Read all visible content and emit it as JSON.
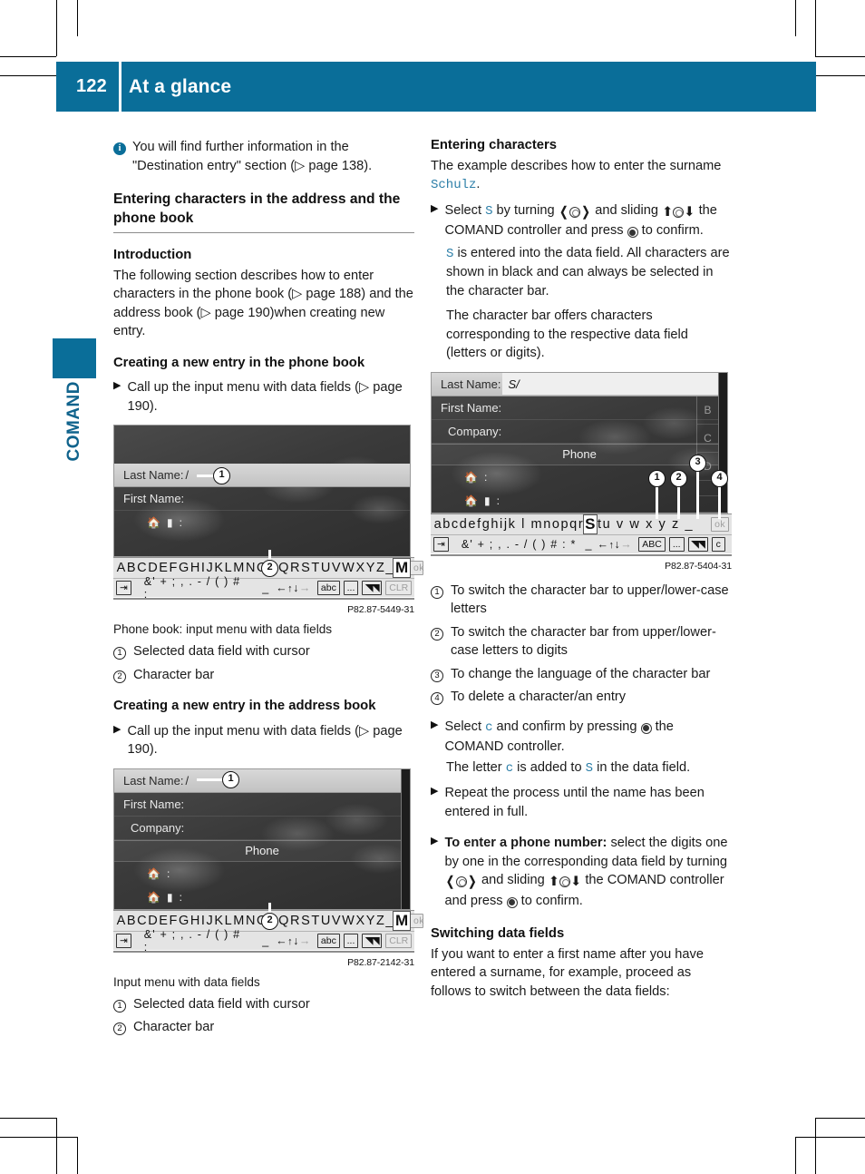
{
  "theme": {
    "brand": "#0a6e99",
    "link_blue": "#2d7fa8"
  },
  "header": {
    "page_number": "122",
    "chapter_title": "At a glance",
    "side_tab_label": "COMAND"
  },
  "left_column": {
    "note": {
      "icon": "info-icon",
      "text": "You will find further information in the \"Destination entry\" section (▷ page 138)."
    },
    "section_heading": "Entering characters in the address and the phone book",
    "intro_heading": "Introduction",
    "intro_text": "The following section describes how to enter characters in the phone book (▷ page 188) and the address book (▷ page 190)when creating new entry.",
    "phonebook_heading": "Creating a new entry in the phone book",
    "phonebook_step": "Call up the input menu with data fields (▷ page 190).",
    "figure1": {
      "fields": [
        {
          "label": "Last Name:",
          "value": "/",
          "selected": true
        },
        {
          "label": "First Name:",
          "value": "",
          "selected": false
        }
      ],
      "icon_rows": [
        {
          "icons": "house-icon mobile-icon",
          "label": ":"
        }
      ],
      "charbar_upper": "ABCDEFGHIJKLMNOPQRSTUVWXYZ_",
      "charbar_highlight": "M",
      "charbar_ok": "ok",
      "charbar_symbols": "&' + ; , . - / ( ) # :",
      "charbar_underscore": "_",
      "charbar_keys": [
        "abc",
        "...",
        "flag-icon",
        "CLR"
      ],
      "back_key": "back-icon",
      "ref": "P82.87-5449-31",
      "caption": "Phone book: input menu with data fields",
      "legend": [
        {
          "num": "1",
          "text": "Selected data field with cursor"
        },
        {
          "num": "2",
          "text": "Character bar"
        }
      ],
      "callouts": [
        "1",
        "2"
      ]
    },
    "addressbook_heading": "Creating a new entry in the address book",
    "addressbook_step": "Call up the input menu with data fields (▷ page 190).",
    "figure2": {
      "fields": [
        {
          "label": "Last Name:",
          "value": "/",
          "selected": true
        },
        {
          "label": "First Name:",
          "value": "",
          "selected": false
        },
        {
          "label": "Company:",
          "value": "",
          "selected": false
        }
      ],
      "section_header": "Phone",
      "icon_rows": [
        {
          "icons": "house-icon",
          "label": ":"
        },
        {
          "icons": "house-icon mobile-icon",
          "label": ":"
        }
      ],
      "charbar_upper": "ABCDEFGHIJKLMNOPQRSTUVWXYZ_",
      "charbar_highlight": "M",
      "charbar_ok": "ok",
      "charbar_symbols": "&' + ; , . - / ( ) # :",
      "charbar_keys": [
        "abc",
        "...",
        "flag-icon",
        "CLR"
      ],
      "ref": "P82.87-2142-31",
      "caption": "Input menu with data fields",
      "legend": [
        {
          "num": "1",
          "text": "Selected data field with cursor"
        },
        {
          "num": "2",
          "text": "Character bar"
        }
      ]
    }
  },
  "right_column": {
    "entering_heading": "Entering characters",
    "entering_intro_a": "The example describes how to enter the surname ",
    "entering_intro_name": "Schulz",
    "entering_intro_b": ".",
    "step1": {
      "a": "Select ",
      "letter": "S",
      "b": " by turning ",
      "c": " and sliding ",
      "d": " the COMAND controller and press ",
      "e": " to confirm."
    },
    "step1_sub_a": "S",
    "step1_sub_b": " is entered into the data field. All characters are shown in black and can always be selected in the character bar.",
    "step1_sub2": "The character bar offers characters corresponding to the respective data field (letters or digits).",
    "figure3": {
      "fields": [
        {
          "label": "Last Name:",
          "value": "S/",
          "selected": true
        },
        {
          "label": "First Name:",
          "value": "",
          "selected": false
        },
        {
          "label": "Company:",
          "value": "",
          "selected": false
        }
      ],
      "section_header": "Phone",
      "rail_letters": [
        "B",
        "C",
        "D"
      ],
      "icon_rows": [
        {
          "icons": "house-icon",
          "label": ":"
        },
        {
          "icons": "house-icon mobile-icon",
          "label": ":"
        }
      ],
      "charbar_lower": "abcdefghijk l mnopqr",
      "charbar_highlight": "S",
      "charbar_lower_tail": "tu v w x y z _",
      "charbar_ok": "ok",
      "charbar_symbols": "&' + ; , . - / ( ) # : *",
      "charbar_keys": [
        "ABC",
        "...",
        "flag-icon",
        "c"
      ],
      "ref": "P82.87-5404-31",
      "callouts": [
        "1",
        "2",
        "3",
        "4"
      ]
    },
    "legend": [
      {
        "num": "1",
        "text": "To switch the character bar to upper/lower-case letters"
      },
      {
        "num": "2",
        "text": "To switch the character bar from upper/lower-case letters to digits"
      },
      {
        "num": "3",
        "text": "To change the language of the character bar"
      },
      {
        "num": "4",
        "text": "To delete a character/an entry"
      }
    ],
    "step2": {
      "a": "Select ",
      "letter": "c",
      "b": " and confirm by pressing ",
      "c": " the COMAND controller."
    },
    "step2_sub": {
      "a": "The letter ",
      "l1": "c",
      "b": " is added to ",
      "l2": "S",
      "c": " in the data field."
    },
    "step3": "Repeat the process until the name has been entered in full.",
    "step4": {
      "bold": "To enter a phone number:",
      "a": " select the digits one by one in the corresponding data field by turning ",
      "b": " and sliding ",
      "c": " the COMAND controller and press ",
      "d": " to confirm."
    },
    "switching_heading": "Switching data fields",
    "switching_text": "If you want to enter a first name after you have entered a surname, for example, proceed as follows to switch between the data fields:"
  }
}
